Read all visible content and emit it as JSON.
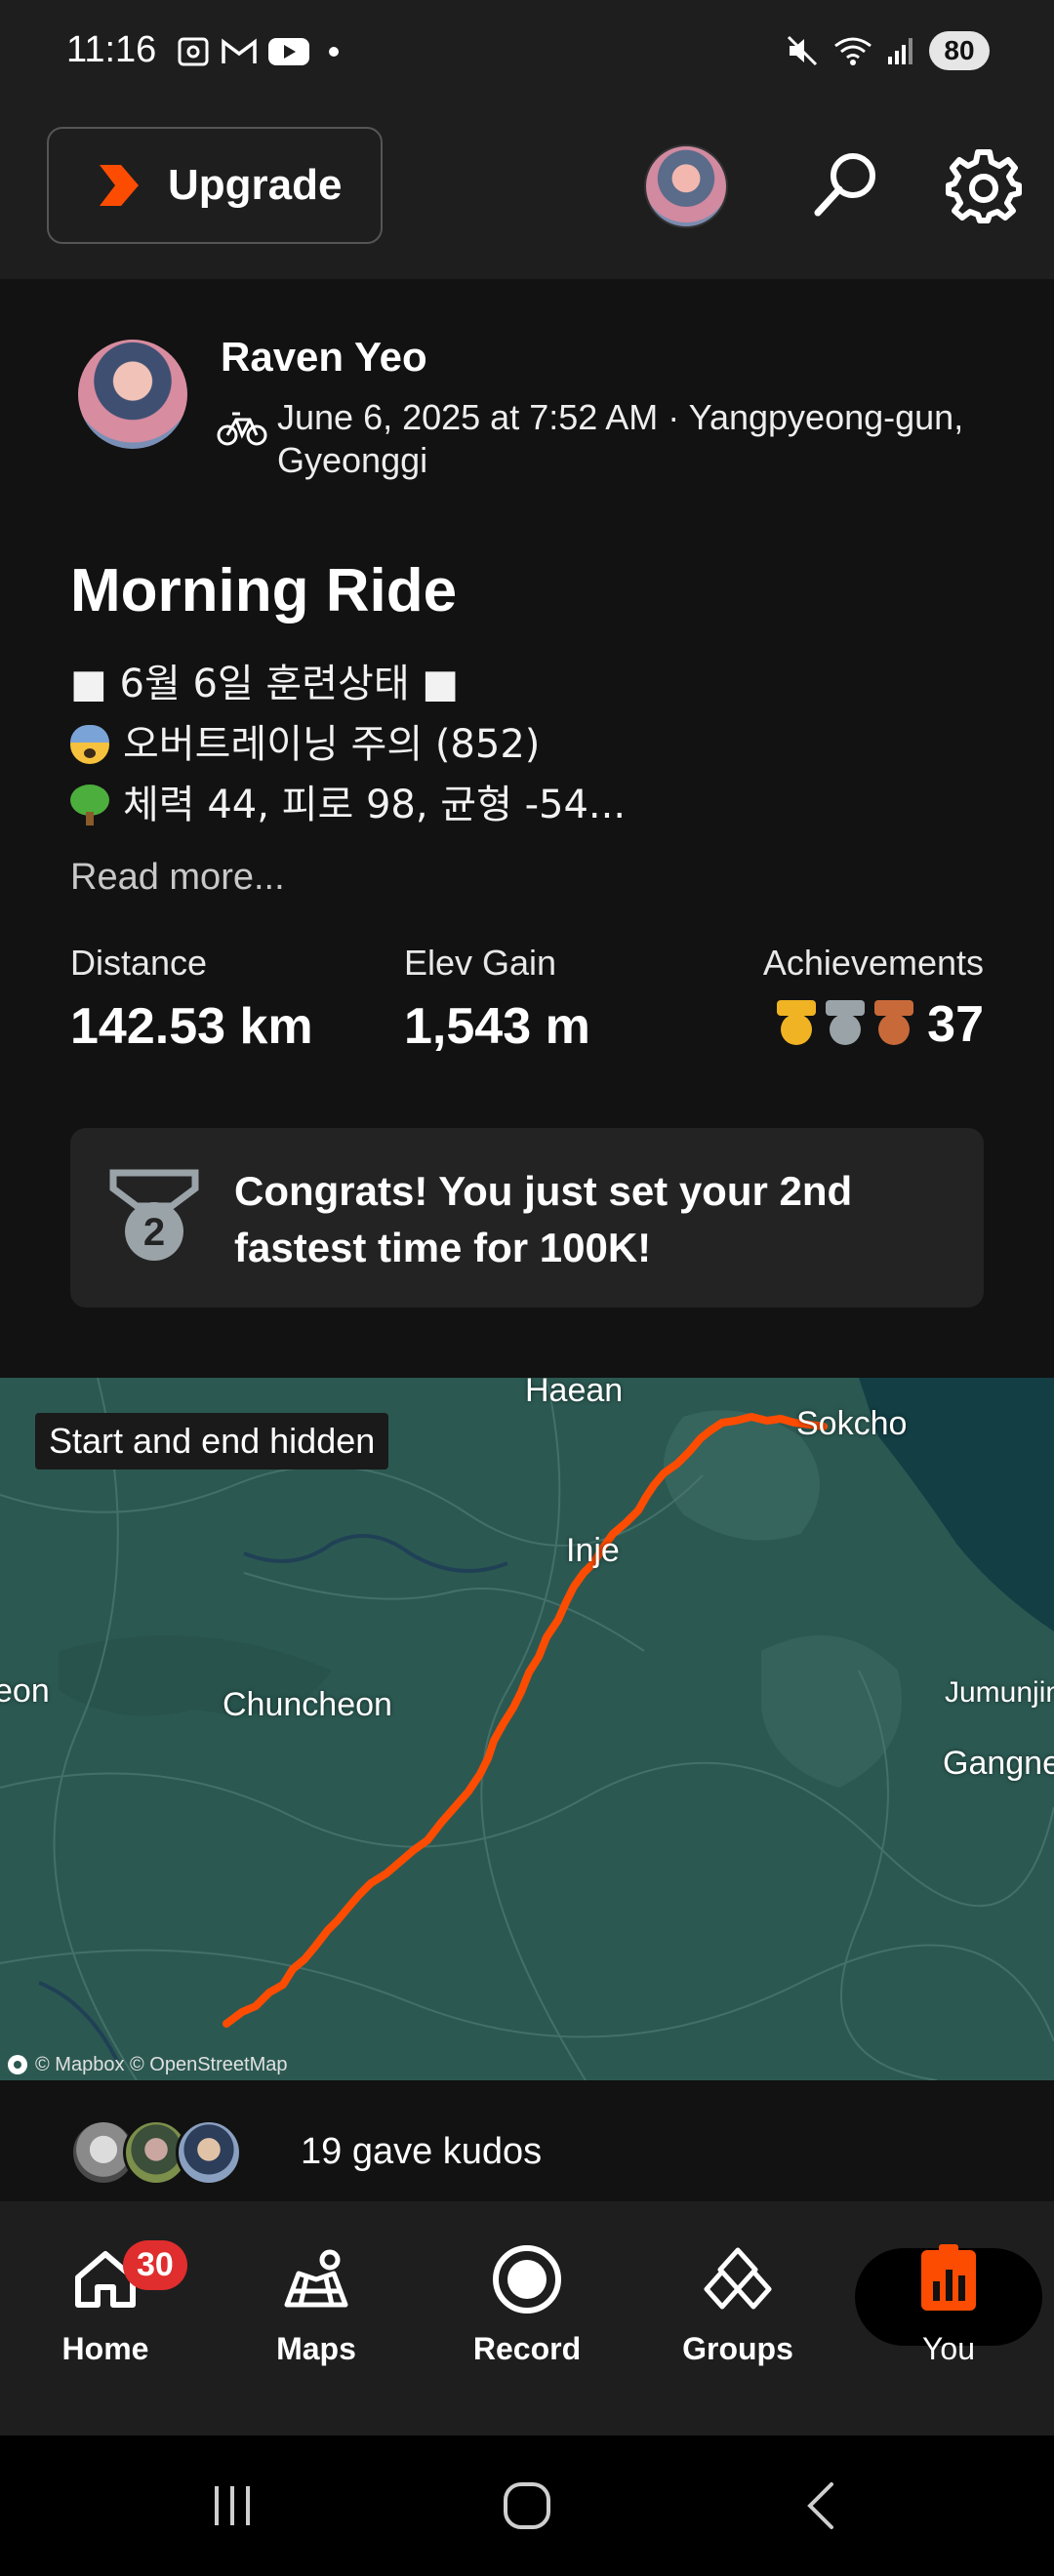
{
  "status_bar": {
    "time": "11:16",
    "battery": "80"
  },
  "header": {
    "upgrade_label": "Upgrade"
  },
  "activity": {
    "athlete_name": "Raven Yeo",
    "meta": "June 6, 2025 at 7:52 AM · Yangpyeong-gun, Gyeonggi",
    "title": "Morning Ride",
    "description_lines": [
      "■ 6월 6일 훈련상태 ■",
      "오버트레이닝 주의 (852)",
      "체력 44, 피로 98, 균형 -54..."
    ],
    "read_more": "Read more...",
    "stats": {
      "distance_label": "Distance",
      "distance_value": "142.53 km",
      "elev_label": "Elev Gain",
      "elev_value": "1,543 m",
      "achievements_label": "Achievements",
      "achievements_count": "37"
    },
    "congrats": {
      "medal_number": "2",
      "text": "Congrats! You just set your 2nd fastest time for 100K!"
    }
  },
  "map": {
    "badge": "Start and end hidden",
    "labels": {
      "haean": "Haean",
      "sokcho": "Sokcho",
      "inje": "Inje",
      "chuncheon": "Chuncheon",
      "eon": "eon",
      "jumunjin": "Jumunjin",
      "gangneung": "Gangne"
    },
    "attribution": "© Mapbox © OpenStreetMap"
  },
  "kudos": {
    "text": "19 gave kudos"
  },
  "bottom_nav": {
    "home_badge": "30",
    "home": "Home",
    "maps": "Maps",
    "record": "Record",
    "groups": "Groups",
    "you": "You"
  },
  "colors": {
    "accent": "#fc4c02",
    "gold": "#f0b323",
    "silver": "#9aa3a8",
    "bronze": "#c8693a",
    "map_base": "#2d5b55",
    "route": "#fc4c02"
  }
}
